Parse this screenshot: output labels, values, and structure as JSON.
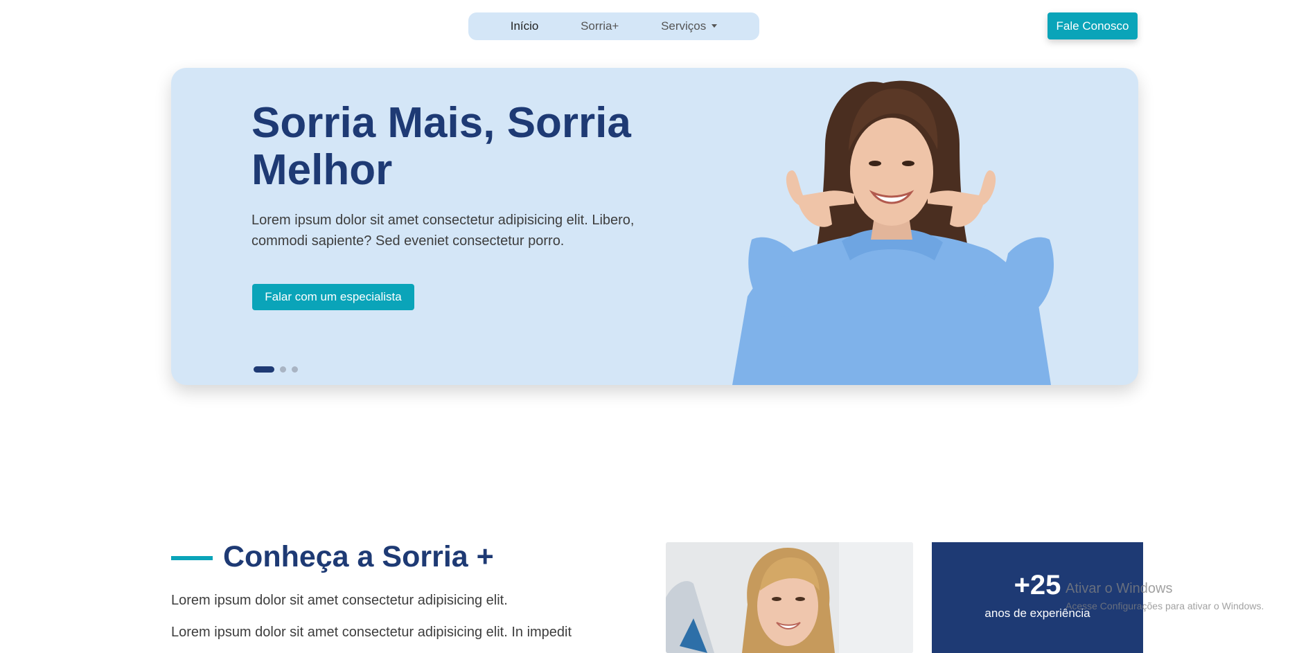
{
  "nav": {
    "items": [
      {
        "label": "Início",
        "active": true
      },
      {
        "label": "Sorria+",
        "active": false
      },
      {
        "label": "Serviços",
        "active": false,
        "dropdown": true
      }
    ],
    "cta_label": "Fale Conosco"
  },
  "hero": {
    "title": "Sorria Mais, Sorria Melhor",
    "description": "Lorem ipsum dolor sit amet consectetur adipisicing elit. Libero, commodi sapiente? Sed eveniet consectetur porro.",
    "button_label": "Falar com um especialista",
    "slides_total": 3,
    "active_slide": 1,
    "image": "smiling-woman-blue-hoodie-pointing-at-smile"
  },
  "about": {
    "title": "Conheça a Sorria +",
    "paragraphs": [
      "Lorem ipsum dolor sit amet consectetur adipisicing elit.",
      "Lorem ipsum dolor sit amet consectetur adipisicing elit. In impedit"
    ],
    "image": "smiling-blonde-woman-dental-clinic",
    "stat": {
      "value": "+25",
      "label": "anos de experiência"
    }
  },
  "watermark": {
    "title": "Ativar o Windows",
    "subtitle": "Acesse Configurações para ativar o Windows."
  },
  "colors": {
    "primary_navy": "#1e3a74",
    "accent_teal": "#0aa4b9",
    "hero_background": "#d4e6f7",
    "hoodie_blue": "#7fb2ea"
  }
}
